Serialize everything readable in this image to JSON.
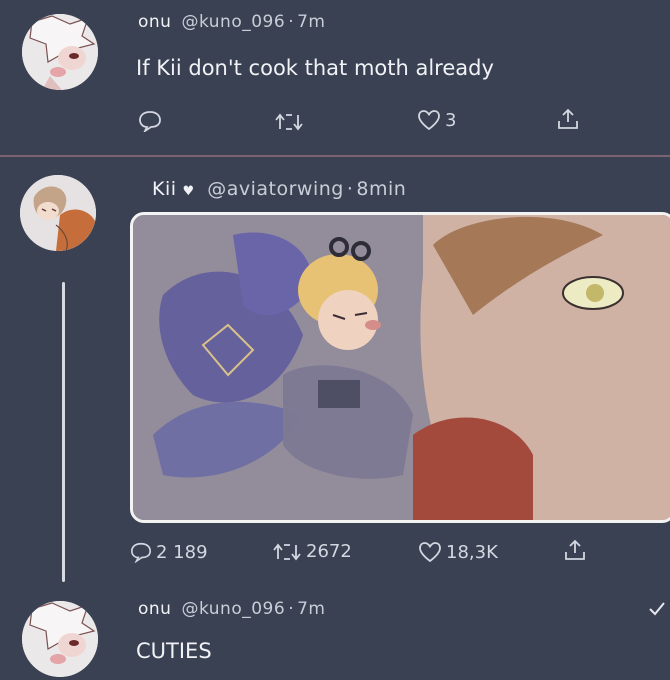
{
  "tweet1": {
    "name": "onu",
    "handle": "@kuno_096",
    "separator": "·",
    "time": "7m",
    "text": "If Kii don't cook that moth already",
    "likes": "3"
  },
  "tweet2": {
    "name": "Kii",
    "name_heart": "♥",
    "handle": "@aviatorwing",
    "separator": "·",
    "time": "8min",
    "replies": "2 189",
    "retweets": "2672",
    "likes": "18,3K"
  },
  "tweet3": {
    "name": "onu",
    "handle": "@kuno_096",
    "separator": "·",
    "time": "7m",
    "text": "CUTIES",
    "status_icon": "check-icon"
  },
  "colors": {
    "background": "#3a4153",
    "divider": "#7b6470",
    "text": "#e9ecf2"
  }
}
